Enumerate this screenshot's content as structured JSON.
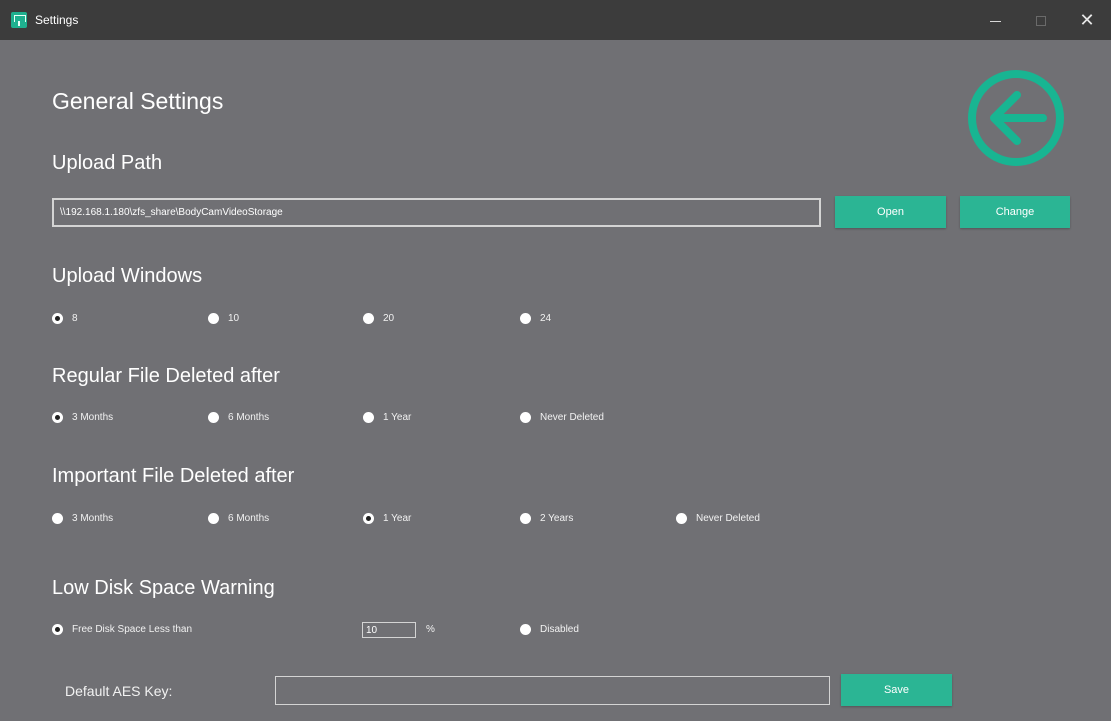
{
  "window": {
    "title": "Settings",
    "minimize_icon": "minimize-icon",
    "maximize_icon": "maximize-icon",
    "close_icon": "close-icon",
    "close_glyph": "✕"
  },
  "accent_color": "#2bb594",
  "background_color": "#707074",
  "page_title": "General Settings",
  "back_icon": "arrow-left-circle-icon",
  "upload_path": {
    "heading": "Upload Path",
    "value": "\\\\192.168.1.180\\zfs_share\\BodyCamVideoStorage",
    "open_label": "Open",
    "change_label": "Change"
  },
  "upload_windows": {
    "heading": "Upload Windows",
    "options": [
      "8",
      "10",
      "20",
      "24"
    ],
    "selected": "8"
  },
  "regular_file": {
    "heading": "Regular File Deleted after",
    "options": [
      "3 Months",
      "6 Months",
      "1 Year",
      "Never Deleted"
    ],
    "selected": "3 Months"
  },
  "important_file": {
    "heading": "Important File Deleted after",
    "options": [
      "3 Months",
      "6 Months",
      "1 Year",
      "2 Years",
      "Never Deleted"
    ],
    "selected": "1 Year"
  },
  "low_disk": {
    "heading": "Low Disk Space Warning",
    "option_free": "Free Disk Space Less than",
    "threshold_value": "10",
    "percent_sign": "%",
    "option_disabled": "Disabled",
    "selected": "Free Disk Space Less than"
  },
  "aes": {
    "label": "Default AES Key:",
    "value": "",
    "save_label": "Save"
  }
}
